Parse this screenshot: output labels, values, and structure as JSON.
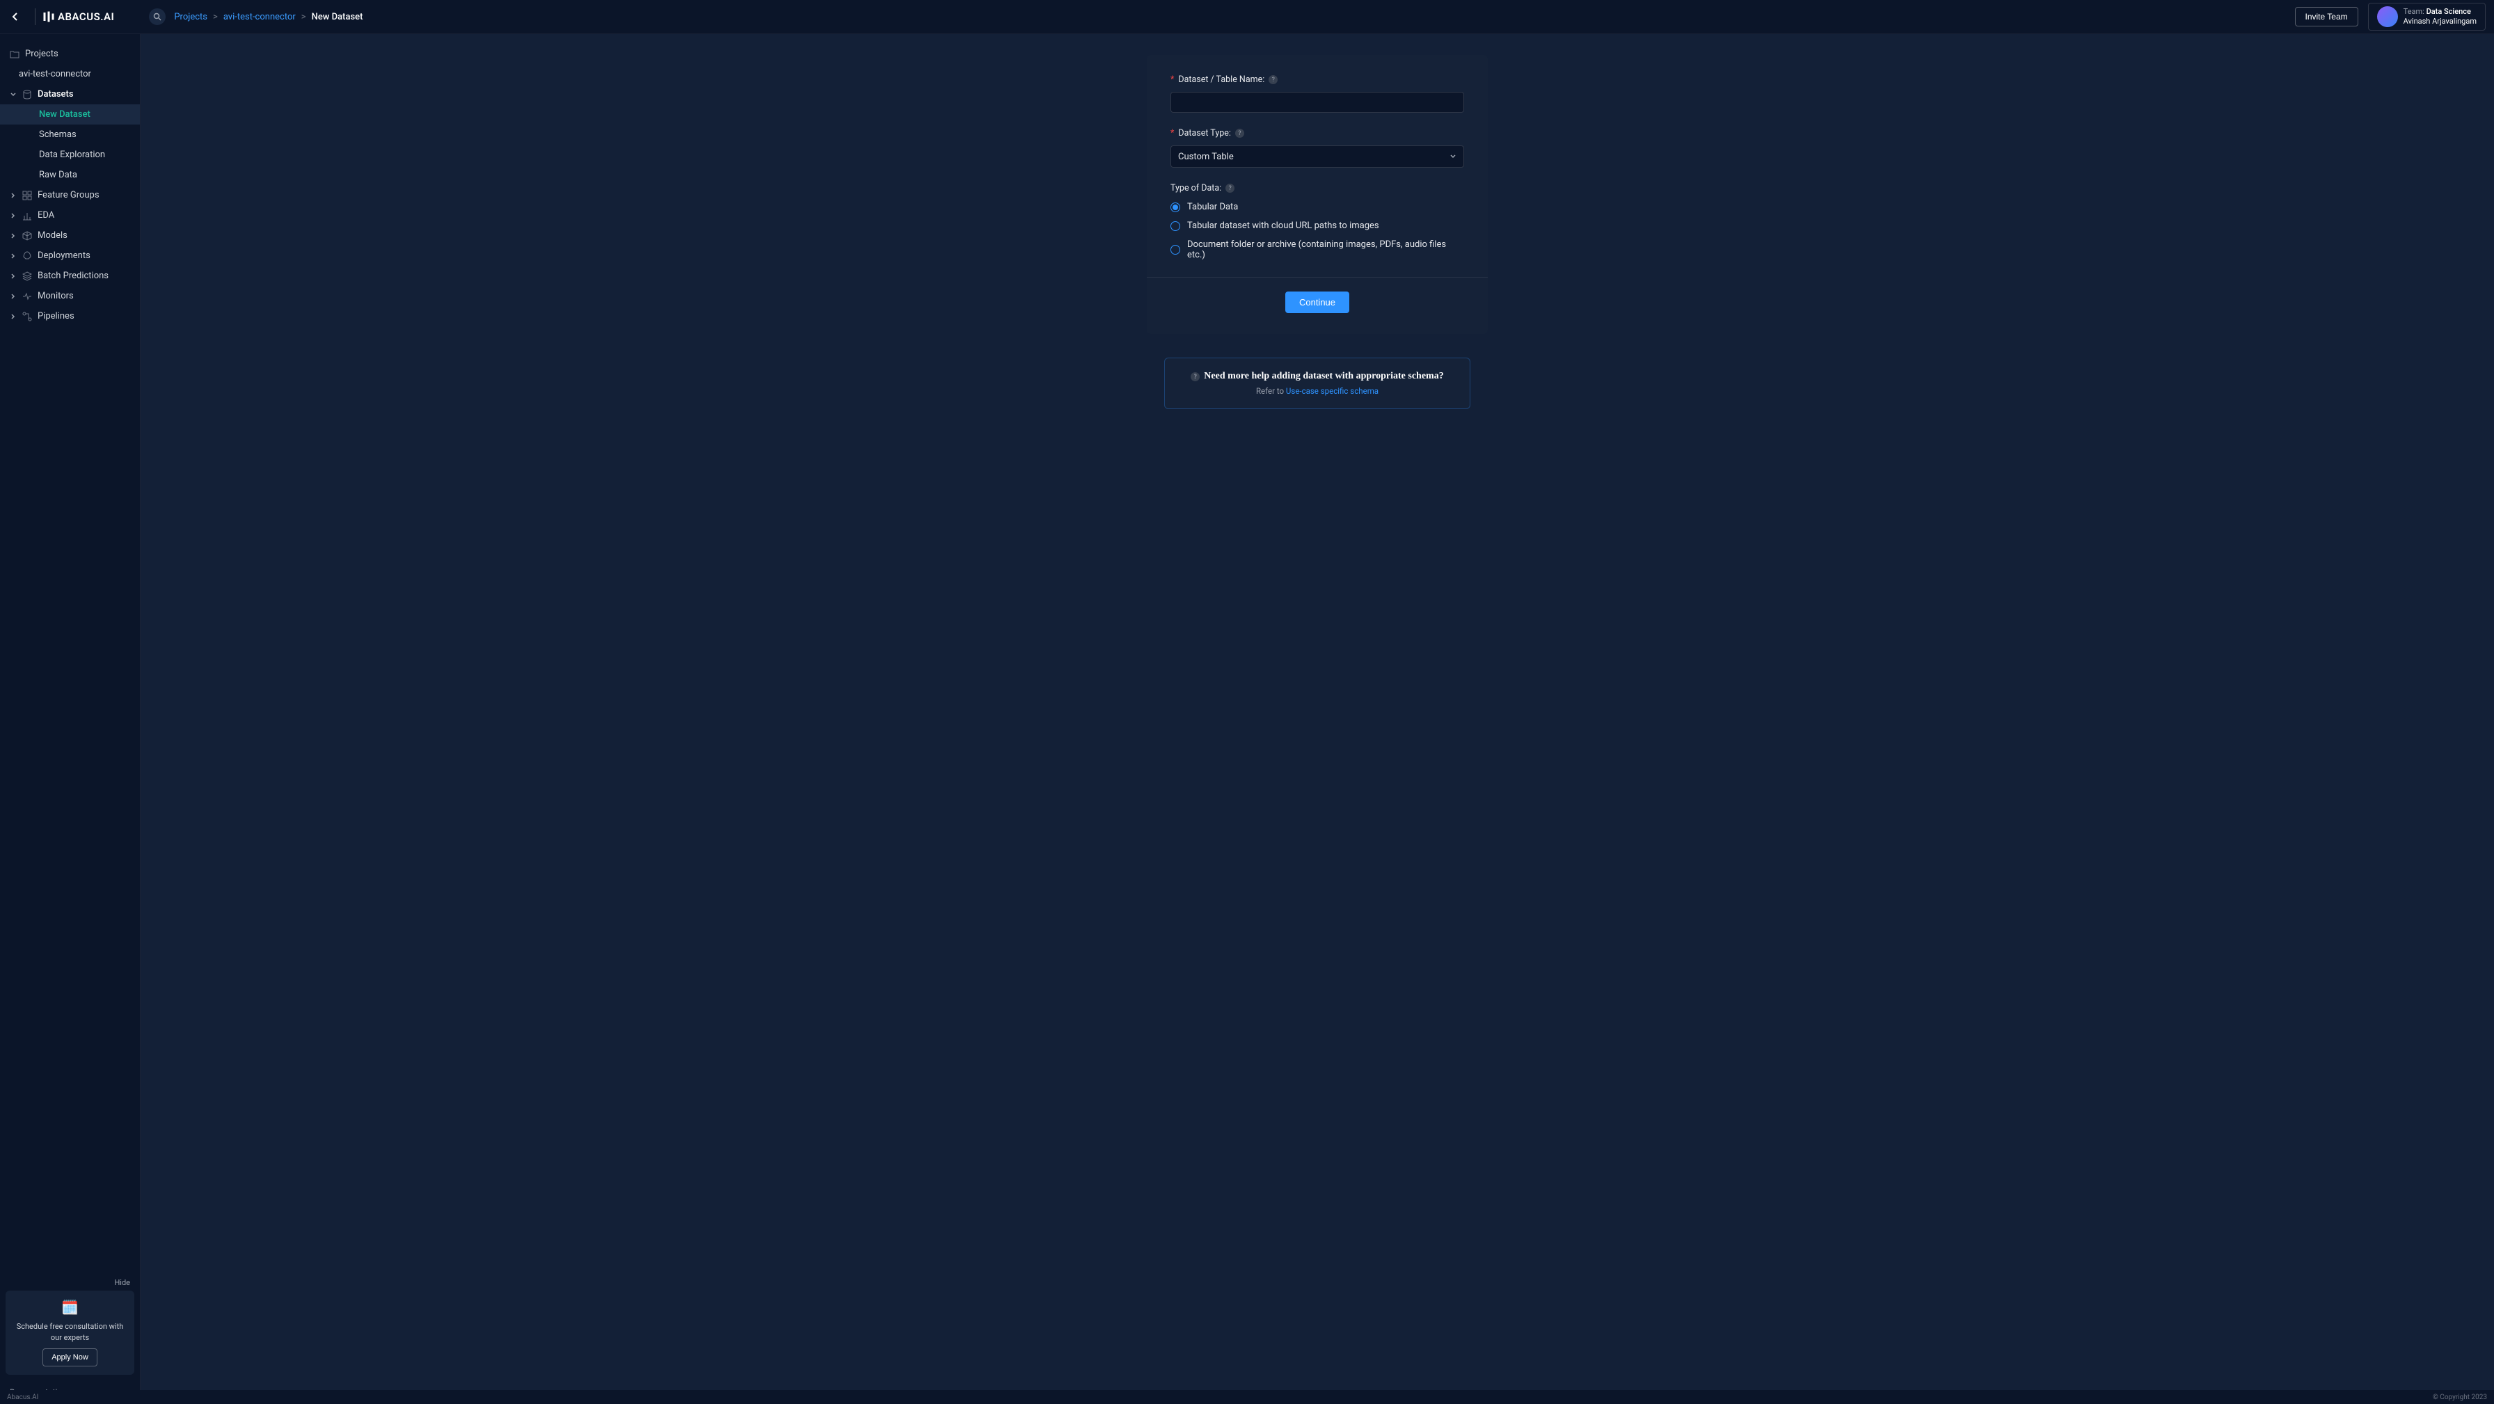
{
  "brand": "ABACUS.AI",
  "breadcrumb": {
    "projects": "Projects",
    "project": "avi-test-connector",
    "current": "New Dataset"
  },
  "topbar": {
    "invite": "Invite Team",
    "team_label": "Team:",
    "team_name": "Data Science",
    "user_name": "Avinash Arjavalingam"
  },
  "sidebar": {
    "projects": "Projects",
    "project_name": "avi-test-connector",
    "datasets": "Datasets",
    "new_dataset": "New Dataset",
    "schemas": "Schemas",
    "data_exploration": "Data Exploration",
    "raw_data": "Raw Data",
    "feature_groups": "Feature Groups",
    "eda": "EDA",
    "models": "Models",
    "deployments": "Deployments",
    "batch_predictions": "Batch Predictions",
    "monitors": "Monitors",
    "pipelines": "Pipelines",
    "promo_hide": "Hide",
    "promo_text": "Schedule free consultation with our experts",
    "promo_btn": "Apply Now",
    "documentation": "Documentation"
  },
  "form": {
    "name_label": "Dataset / Table Name:",
    "name_value": "",
    "type_label": "Dataset Type:",
    "type_value": "Custom Table",
    "data_type_label": "Type of Data:",
    "radio1": "Tabular Data",
    "radio2": "Tabular dataset with cloud URL paths to images",
    "radio3": "Document folder or archive (containing images, PDFs, audio files etc.)",
    "continue": "Continue"
  },
  "help": {
    "title": "Need more help adding dataset with appropriate schema?",
    "refer": "Refer to ",
    "link": "Use-case specific schema"
  },
  "footer": {
    "left": "Abacus.AI",
    "right": "© Copyright 2023"
  }
}
